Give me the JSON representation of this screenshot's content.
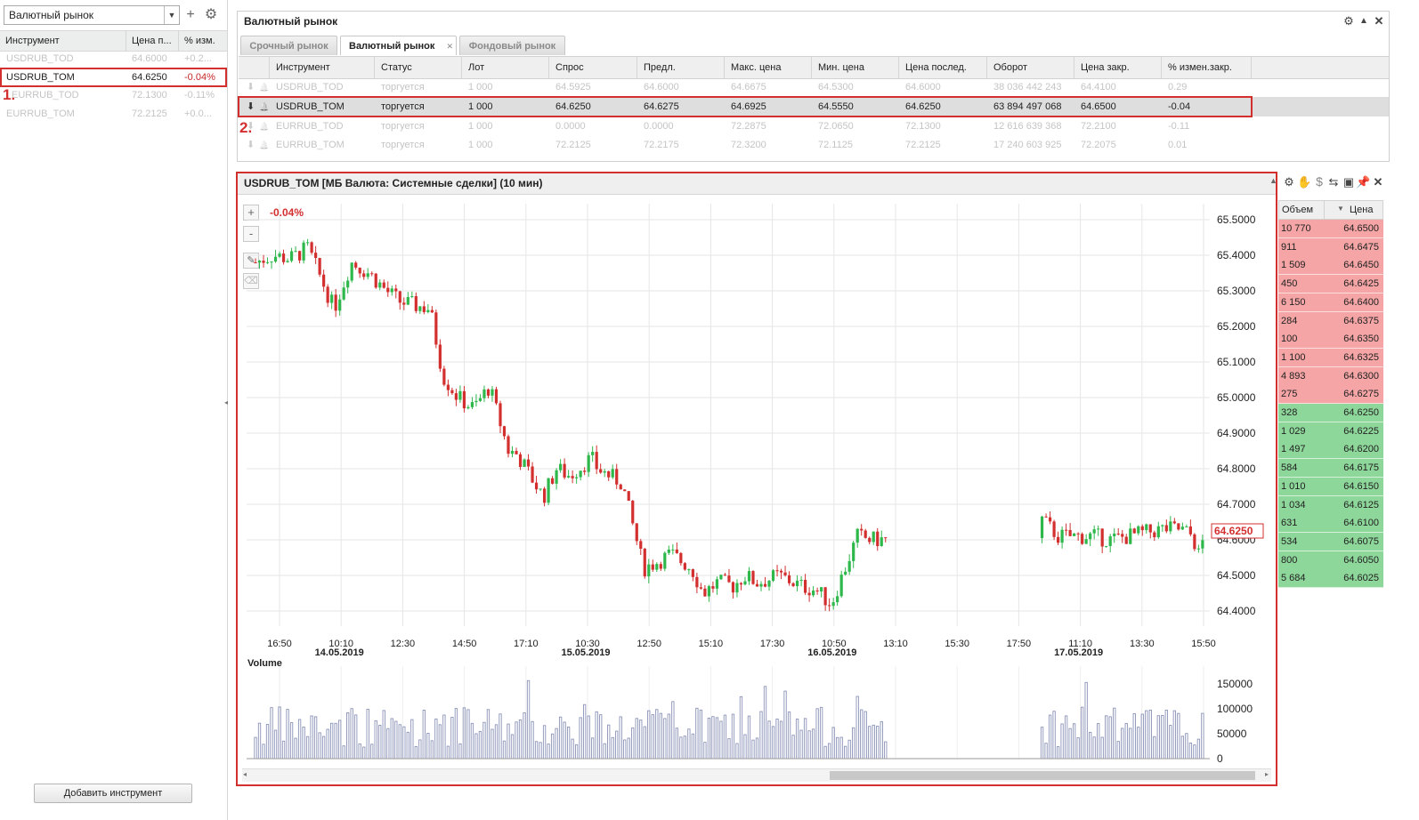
{
  "left_panel": {
    "market_select": "Валютный рынок",
    "columns": [
      "Инструмент",
      "Цена п...",
      "% изм."
    ],
    "rows": [
      {
        "name": "USDRUB_TOD",
        "price": "64.6000",
        "chg": "+0.2..."
      },
      {
        "name": "USDRUB_TOM",
        "price": "64.6250",
        "chg": "-0.04%"
      },
      {
        "name": "EURRUB_TOD",
        "price": "72.1300",
        "chg": "-0.11%"
      },
      {
        "name": "EURRUB_TOM",
        "price": "72.2125",
        "chg": "+0.0..."
      }
    ],
    "add_button": "Добавить инструмент",
    "marker": "1."
  },
  "top_panel": {
    "title": "Валютный рынок",
    "tabs": [
      "Срочный рынок",
      "Валютный рынок",
      "Фондовый рынок"
    ],
    "columns": [
      "Инструмент",
      "Статус",
      "Лот",
      "Спрос",
      "Предл.",
      "Макс. цена",
      "Мин. цена",
      "Цена послед.",
      "Оборот",
      "Цена закр.",
      "% измен.закр."
    ],
    "rows": [
      [
        "USDRUB_TOD",
        "торгуется",
        "1 000",
        "64.5925",
        "64.6000",
        "64.6675",
        "64.5300",
        "64.6000",
        "38 036 442 243",
        "64.4100",
        "0.29"
      ],
      [
        "USDRUB_TOM",
        "торгуется",
        "1 000",
        "64.6250",
        "64.6275",
        "64.6925",
        "64.5550",
        "64.6250",
        "63 894 497 068",
        "64.6500",
        "-0.04"
      ],
      [
        "EURRUB_TOD",
        "торгуется",
        "1 000",
        "0.0000",
        "0.0000",
        "72.2875",
        "72.0650",
        "72.1300",
        "12 616 639 368",
        "72.2100",
        "-0.11"
      ],
      [
        "EURRUB_TOM",
        "торгуется",
        "1 000",
        "72.2125",
        "72.2175",
        "72.3200",
        "72.1125",
        "72.2125",
        "17 240 603 925",
        "72.2075",
        "0.01"
      ]
    ],
    "marker": "2."
  },
  "chart_panel": {
    "title": "USDRUB_TOM [МБ Валюта: Системные сделки] (10 мин)",
    "change_label": "-0.04%",
    "zoom_in": "+",
    "zoom_out": "-",
    "volume_label": "Volume"
  },
  "chart_data": {
    "type": "candlestick",
    "instrument": "USDRUB_TOM",
    "ylim": [
      64.37,
      65.5
    ],
    "y_ticks": [
      "65.5000",
      "65.4000",
      "65.3000",
      "65.2000",
      "65.1000",
      "65.0000",
      "64.9000",
      "64.8000",
      "64.7000",
      "64.6000",
      "64.5000",
      "64.4000"
    ],
    "x_ticks": [
      "16:50",
      "10:10",
      "12:30",
      "14:50",
      "17:10",
      "10:30",
      "12:50",
      "15:10",
      "17:30",
      "10:50",
      "13:10",
      "15:30",
      "17:50",
      "11:10",
      "13:30",
      "15:50"
    ],
    "date_labels": [
      "14.05.2019",
      "15.05.2019",
      "16.05.2019",
      "17.05.2019"
    ],
    "last_price": "64.6250",
    "trend": {
      "x": [
        0,
        20,
        40,
        60,
        90,
        110,
        130,
        150,
        165,
        180,
        200,
        215,
        232,
        250,
        268,
        290,
        300,
        330,
        345,
        360,
        385,
        392,
        420,
        445,
        462,
        476,
        500,
        513,
        530,
        548,
        560,
        575,
        590,
        600,
        625,
        642,
        660,
        690,
        706,
        724
      ],
      "y": [
        65.38,
        65.4,
        65.39,
        65.42,
        65.25,
        65.38,
        65.35,
        65.3,
        65.27,
        65.26,
        65.25,
        65.06,
        65.0,
        64.97,
        65.03,
        64.85,
        64.84,
        64.72,
        64.8,
        64.78,
        64.83,
        64.8,
        64.76,
        64.52,
        64.54,
        64.56,
        64.52,
        64.45,
        64.48,
        64.47,
        64.5,
        64.48,
        64.49,
        64.5,
        64.47,
        64.46,
        64.42,
        64.61,
        64.6,
        64.6
      ]
    },
    "gap": [
      750,
      857
    ],
    "segment2": {
      "x": [
        900,
        920,
        940,
        960,
        980,
        1000,
        1020,
        1040,
        1060,
        1075,
        1080,
        1090
      ],
      "y": [
        64.66,
        64.61,
        64.61,
        64.61,
        64.6,
        64.61,
        64.62,
        64.63,
        64.63,
        64.61,
        64.55,
        64.63
      ]
    },
    "volume_ylim": [
      0,
      150000
    ],
    "volume_ticks": [
      "150000",
      "100000",
      "50000",
      "0"
    ]
  },
  "order_book": {
    "columns": [
      "Объем",
      "Цена"
    ],
    "asks": [
      {
        "vol": "10 770",
        "price": "64.6500"
      },
      {
        "vol": "911",
        "price": "64.6475"
      },
      {
        "vol": "1 509",
        "price": "64.6450"
      },
      {
        "vol": "450",
        "price": "64.6425"
      },
      {
        "vol": "6 150",
        "price": "64.6400"
      },
      {
        "vol": "284",
        "price": "64.6375"
      },
      {
        "vol": "100",
        "price": "64.6350"
      },
      {
        "vol": "1 100",
        "price": "64.6325"
      },
      {
        "vol": "4 893",
        "price": "64.6300"
      },
      {
        "vol": "275",
        "price": "64.6275"
      }
    ],
    "bids": [
      {
        "vol": "328",
        "price": "64.6250"
      },
      {
        "vol": "1 029",
        "price": "64.6225"
      },
      {
        "vol": "1 497",
        "price": "64.6200"
      },
      {
        "vol": "584",
        "price": "64.6175"
      },
      {
        "vol": "1 010",
        "price": "64.6150"
      },
      {
        "vol": "1 034",
        "price": "64.6125"
      },
      {
        "vol": "631",
        "price": "64.6100"
      },
      {
        "vol": "534",
        "price": "64.6075"
      },
      {
        "vol": "800",
        "price": "64.6050"
      },
      {
        "vol": "5 684",
        "price": "64.6025"
      }
    ]
  },
  "colors": {
    "up": "#2eb84b",
    "down": "#d32f2f",
    "highlight": "#d32f2f",
    "ask_bg": "#f5a5a5",
    "bid_bg": "#8ed79a",
    "volume": "#8b93b8"
  }
}
